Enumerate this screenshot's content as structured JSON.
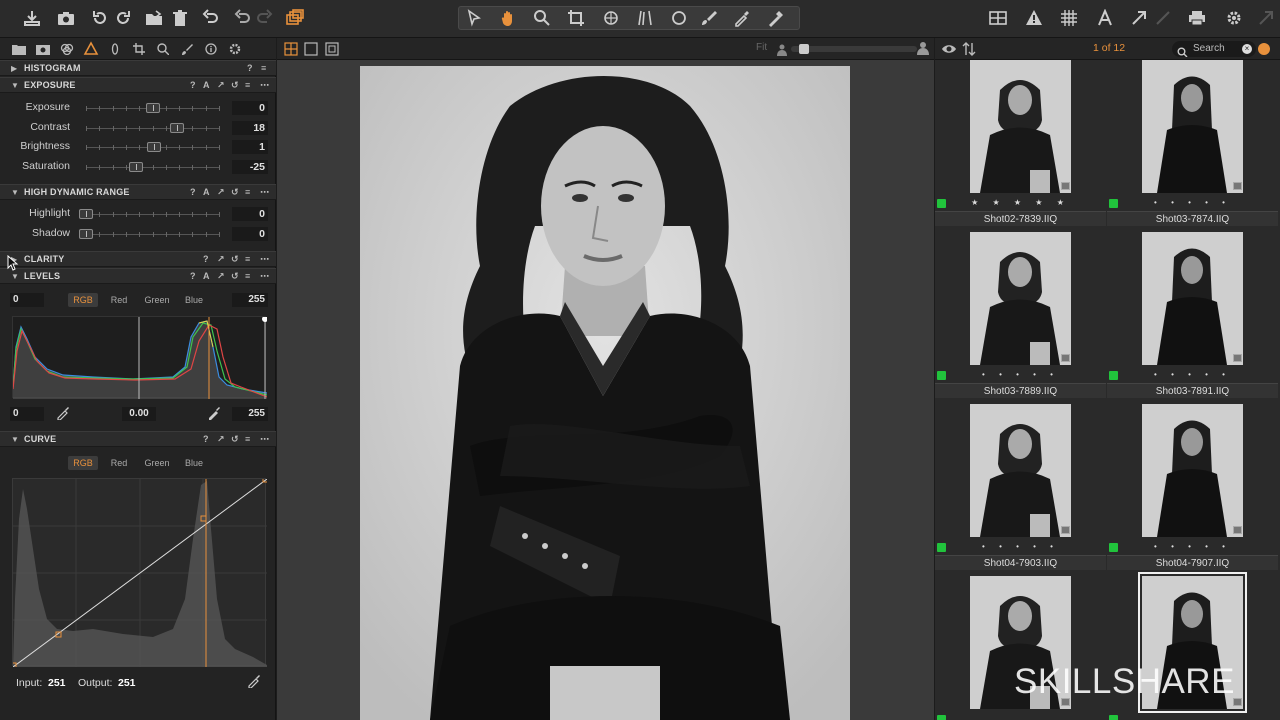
{
  "toolbar": {
    "colors": {
      "accent": "#e8913c"
    }
  },
  "viewer": {
    "fit_label": "Fit"
  },
  "browser": {
    "counter": "1 of 12",
    "search_placeholder": "Search",
    "thumbnails": [
      {
        "name": "Shot02-7839.IIQ",
        "stars": "★ ★ ★ ★ ★",
        "color_tag": "#21c33c"
      },
      {
        "name": "Shot03-7874.IIQ",
        "stars": "• • • • •",
        "color_tag": "#21c33c"
      },
      {
        "name": "Shot03-7889.IIQ",
        "stars": "• • • • •",
        "color_tag": "#21c33c"
      },
      {
        "name": "Shot03-7891.IIQ",
        "stars": "• • • • •",
        "color_tag": "#21c33c"
      },
      {
        "name": "Shot04-7903.IIQ",
        "stars": "• • • • •",
        "color_tag": "#21c33c"
      },
      {
        "name": "Shot04-7907.IIQ",
        "stars": "• • • • •",
        "color_tag": "#21c33c"
      },
      {
        "name": "",
        "stars": "",
        "color_tag": "#21c33c"
      },
      {
        "name": "",
        "stars": "",
        "color_tag": "#21c33c"
      }
    ]
  },
  "panel": {
    "histogram": {
      "title": "HISTOGRAM"
    },
    "exposure": {
      "title": "EXPOSURE",
      "sliders": [
        {
          "label": "Exposure",
          "value": "0",
          "pos": 0.5
        },
        {
          "label": "Contrast",
          "value": "18",
          "pos": 0.68
        },
        {
          "label": "Brightness",
          "value": "1",
          "pos": 0.51
        },
        {
          "label": "Saturation",
          "value": "-25",
          "pos": 0.375
        }
      ]
    },
    "hdr": {
      "title": "HIGH DYNAMIC RANGE",
      "sliders": [
        {
          "label": "Highlight",
          "value": "0",
          "pos": 0.0
        },
        {
          "label": "Shadow",
          "value": "0",
          "pos": 0.0
        }
      ]
    },
    "clarity": {
      "title": "CLARITY"
    },
    "levels": {
      "title": "LEVELS",
      "channels": [
        "RGB",
        "Red",
        "Green",
        "Blue"
      ],
      "input_low": "0",
      "input_high": "255",
      "output_low": "0",
      "midtone": "0.00",
      "output_high": "255"
    },
    "curve": {
      "title": "CURVE",
      "channels": [
        "RGB",
        "Red",
        "Green",
        "Blue"
      ],
      "input_label": "Input:",
      "input_value": "251",
      "output_label": "Output:",
      "output_value": "251"
    }
  },
  "watermark": "SKILLSHARE"
}
